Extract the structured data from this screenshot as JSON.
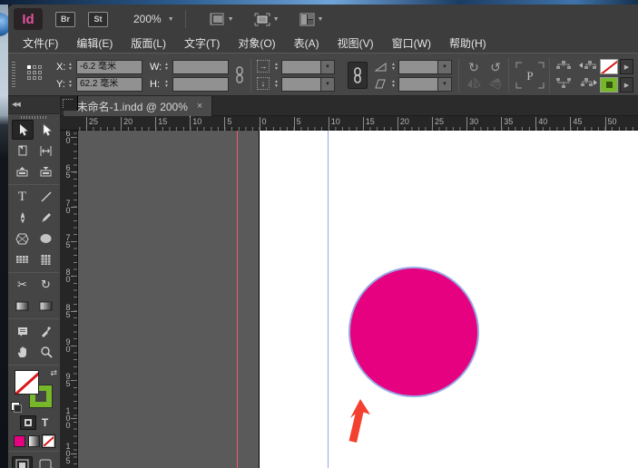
{
  "app_bar": {
    "logo": "Id",
    "bridge_label": "Br",
    "stock_label": "St",
    "zoom_level": "200%"
  },
  "menu_bar": {
    "items": [
      "文件(F)",
      "编辑(E)",
      "版面(L)",
      "文字(T)",
      "对象(O)",
      "表(A)",
      "视图(V)",
      "窗口(W)",
      "帮助(H)"
    ]
  },
  "control_panel": {
    "x_label": "X:",
    "x_value": "-6.2 毫米",
    "y_label": "Y:",
    "y_value": "62.2 毫米",
    "w_label": "W:",
    "w_value": "",
    "h_label": "H:",
    "h_value": "",
    "p_badge": "P"
  },
  "document_tab": {
    "title": "*未命名-1.indd @ 200%"
  },
  "rulers": {
    "horizontal_labels": [
      "25",
      "20",
      "15",
      "10",
      "5",
      "0",
      "5",
      "10",
      "15",
      "20",
      "25",
      "30",
      "35",
      "40",
      "45",
      "50"
    ],
    "vertical_labels": [
      "60",
      "65",
      "70",
      "75",
      "80",
      "85",
      "90",
      "95",
      "100",
      "105"
    ]
  },
  "icons": {
    "dropdown": "▼",
    "stepper_up": "▲",
    "stepper_down": "▼",
    "collapse": "◀◀",
    "close": "×",
    "scissors": "✂",
    "free_transform": "↻",
    "rotate_cw": "↻",
    "rotate_ccw": "↺",
    "type_tool": "T",
    "text_format": "T",
    "swap_arrow": "⇄",
    "scale_x_arrow": "→",
    "scale_y_arrow": "↓",
    "panel_arrow": "▶"
  },
  "colors": {
    "magenta": "#e5017f",
    "stroke_green": "#76b82a",
    "guide_blue": "#99a7e6",
    "bleed_red": "#f4586e",
    "arrow_red": "#f4402e"
  }
}
